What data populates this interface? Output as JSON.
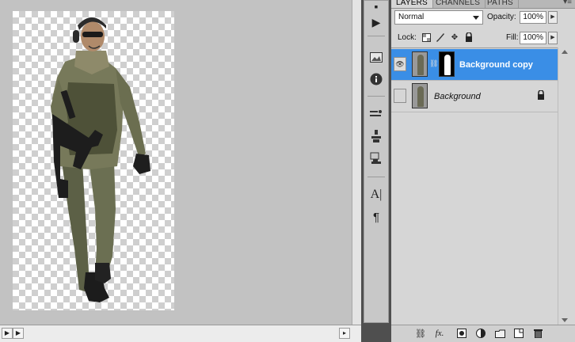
{
  "panel": {
    "tabs": [
      {
        "label": "LAYERS",
        "active": true
      },
      {
        "label": "CHANNELS",
        "active": false
      },
      {
        "label": "PATHS",
        "active": false
      }
    ],
    "blend_mode": "Normal",
    "opacity_label": "Opacity:",
    "opacity_value": "100%",
    "lock_label": "Lock:",
    "fill_label": "Fill:",
    "fill_value": "100%",
    "layers": [
      {
        "name": "Background copy",
        "selected": true,
        "visible": true,
        "has_mask": true
      },
      {
        "name": "Background",
        "selected": false,
        "visible": false,
        "locked": true
      }
    ],
    "footer_icons": [
      "link-layers-icon",
      "layer-style-icon",
      "add-mask-icon",
      "adjustment-layer-icon",
      "new-group-icon",
      "new-layer-icon",
      "delete-layer-icon"
    ]
  },
  "dock": {
    "icons": [
      "play-icon",
      "navigator-icon",
      "info-icon",
      "brushes-icon",
      "clone-source-icon",
      "tool-presets-icon",
      "character-icon",
      "paragraph-icon"
    ]
  },
  "colors": {
    "selection": "#3a8ee6",
    "panel_bg": "#d6d6d6",
    "dock_bg": "#4f4f4f",
    "canvas_bg": "#c2c2c2"
  }
}
